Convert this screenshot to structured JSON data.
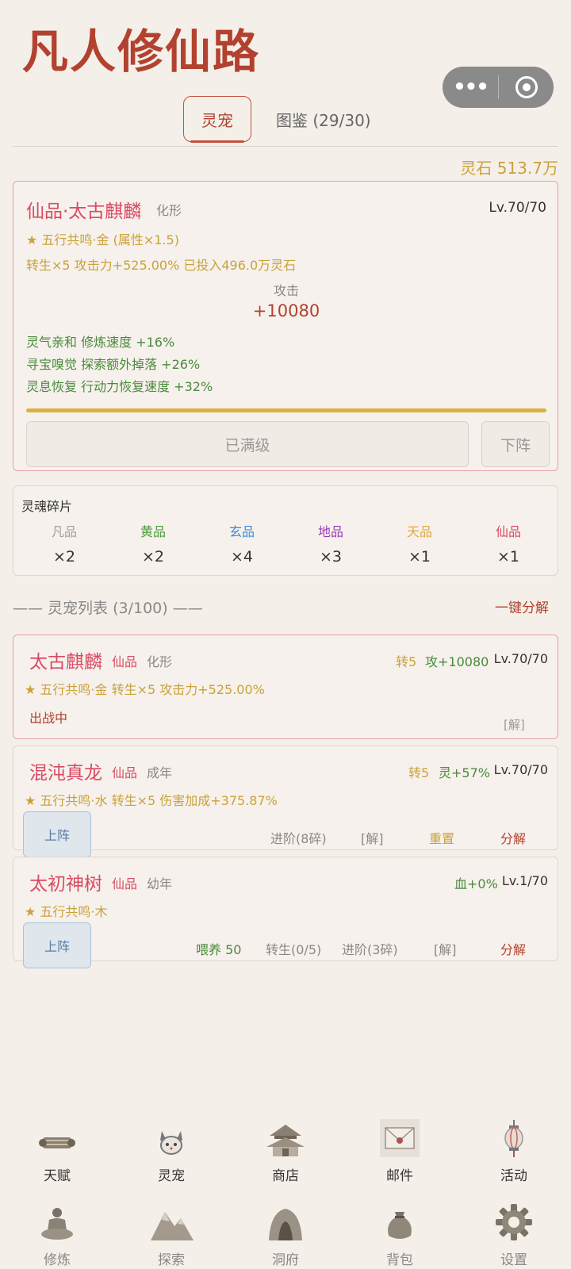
{
  "app_title": "凡人修仙路",
  "tabs": {
    "active": "灵宠",
    "other": "图鉴 (29/30)"
  },
  "spirit_stones": "灵石 513.7万",
  "active_pet": {
    "name": "仙品·太古麒麟",
    "form": "化形",
    "level": "Lv.70/70",
    "resonance": "★ 五行共鸣·金 (属性×1.5)",
    "rebirth_line": "转生×5  攻击力+525.00%  已投入496.0万灵石",
    "stat_label": "攻击",
    "stat_value": "+10080",
    "traits": [
      "灵气亲和 修炼速度 +16%",
      "寻宝嗅觉 探索额外掉落 +26%",
      "灵息恢复 行动力恢复速度 +32%"
    ],
    "progress": 1.0,
    "max_button": "已满级",
    "remove_button": "下阵"
  },
  "fragments": {
    "title": "灵魂碎片",
    "items": [
      {
        "quality": "凡品",
        "count": "×2",
        "color": "#a0a0a0"
      },
      {
        "quality": "黄品",
        "count": "×2",
        "color": "#4a9a3c"
      },
      {
        "quality": "玄品",
        "count": "×4",
        "color": "#3a8ad8"
      },
      {
        "quality": "地品",
        "count": "×3",
        "color": "#9a3ab8"
      },
      {
        "quality": "天品",
        "count": "×1",
        "color": "#e0a840"
      },
      {
        "quality": "仙品",
        "count": "×1",
        "color": "#d94a64"
      }
    ]
  },
  "pet_list": {
    "header": "—— 灵宠列表 (3/100) ——",
    "one_click": "一键分解",
    "pets": [
      {
        "name": "太古麒麟",
        "grade": "仙品",
        "form": "化形",
        "rebirth": "转5",
        "bonus": "攻+10080",
        "level": "Lv.70/70",
        "detail": "★ 五行共鸣·金  转生×5 攻击力+525.00%",
        "status": "出战中",
        "decompose": "[解]"
      },
      {
        "name": "混沌真龙",
        "grade": "仙品",
        "form": "成年",
        "rebirth": "转5",
        "bonus": "灵+57%",
        "level": "Lv.70/70",
        "detail": "★ 五行共鸣·水  转生×5 伤害加成+375.87%",
        "deploy": "上阵",
        "advance": "进阶(8碎)",
        "decompose": "[解]",
        "reset": "重置",
        "dismantle": "分解"
      },
      {
        "name": "太初神树",
        "grade": "仙品",
        "form": "幼年",
        "bonus": "血+0%",
        "level": "Lv.1/70",
        "detail": "★ 五行共鸣·木",
        "deploy": "上阵",
        "feed": "喂养 50",
        "rebirth_btn": "转生(0/5)",
        "advance": "进阶(3碎)",
        "decompose": "[解]",
        "dismantle": "分解"
      }
    ]
  },
  "nav_row1": [
    "天赋",
    "灵宠",
    "商店",
    "邮件",
    "活动"
  ],
  "nav_row2": [
    "修炼",
    "探索",
    "洞府",
    "背包",
    "设置"
  ]
}
